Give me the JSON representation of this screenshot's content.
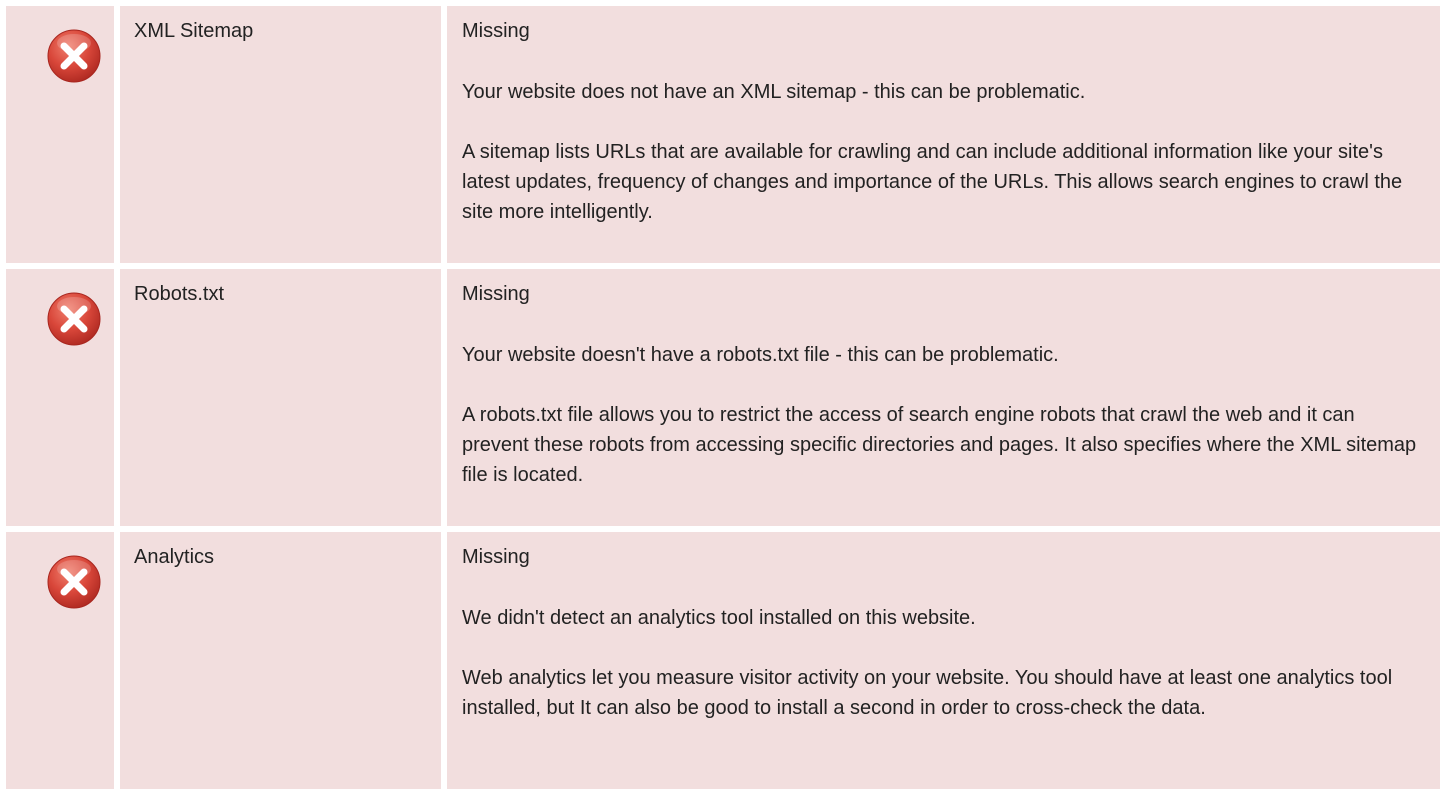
{
  "colors": {
    "cell_background": "#f2dede",
    "error_icon": "#d9473a"
  },
  "checks": [
    {
      "icon": "error-x-icon",
      "name": "XML Sitemap",
      "status": "Missing",
      "summary": "Your website does not have an XML sitemap - this can be problematic.",
      "description": "A sitemap lists URLs that are available for crawling and can include additional information like your site's latest updates, frequency of changes and importance of the URLs. This allows search engines to crawl the site more intelligently."
    },
    {
      "icon": "error-x-icon",
      "name": "Robots.txt",
      "status": "Missing",
      "summary": "Your website doesn't have a robots.txt file - this can be problematic.",
      "description": "A robots.txt file allows you to restrict the access of search engine robots that crawl the web and it can prevent these robots from accessing specific directories and pages. It also specifies where the XML sitemap file is located."
    },
    {
      "icon": "error-x-icon",
      "name": "Analytics",
      "status": "Missing",
      "summary": "We didn't detect an analytics tool installed on this website.",
      "description": "Web analytics let you measure visitor activity on your website. You should have at least one analytics tool installed, but It can also be good to install a second in order to cross-check the data."
    }
  ]
}
